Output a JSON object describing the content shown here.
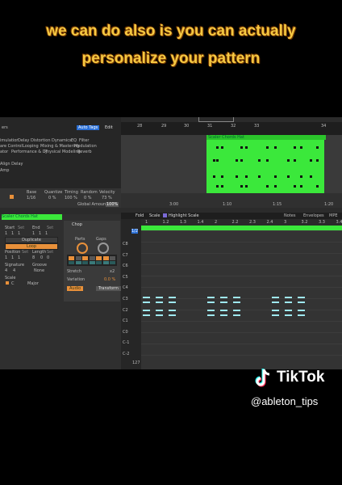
{
  "caption": {
    "line1": "we can do also is you can actually",
    "line2": "personalize your pattern"
  },
  "browser": {
    "items": [
      "ers",
      "imulation",
      "Delay",
      "Distortion",
      "Dynamics",
      "EQ",
      "Filter",
      "are Control",
      "Looping",
      "Mixing & Mastering",
      "Modulation",
      "ator",
      "Performance & DJ",
      "Physical Modeling",
      "Reverb"
    ],
    "auto_tags": "Auto Tags",
    "edit": "Edit",
    "align_delay": "Align Delay",
    "amp": "Amp"
  },
  "grooves": {
    "headers": [
      "Base",
      "Quantize",
      "Timing",
      "Random",
      "Velocity"
    ],
    "values": [
      "1/16",
      "0 %",
      "100 %",
      "0 %",
      "73 %"
    ],
    "global_amount": "Global Amount",
    "global_value": "100%"
  },
  "arrangement": {
    "ruler_top": [
      "28",
      "29",
      "30",
      "31",
      "32",
      "33",
      "34"
    ],
    "clip_name": "Scaler Chords Hat",
    "ruler_bottom": [
      "3:00",
      "1:10",
      "1:15",
      "1:20"
    ]
  },
  "clip_panel": {
    "title": "Scaler Chords Hat",
    "start": "Start",
    "set": "Set",
    "end": "End",
    "start_vals": [
      "1",
      "1",
      "1"
    ],
    "end_vals": [
      "1",
      "1",
      "1"
    ],
    "duplicate": "Duplicate",
    "loop": "Loop",
    "position": "Position",
    "length": "Length",
    "pos_vals": [
      "1",
      "1",
      "1"
    ],
    "len_vals": [
      "8",
      "0",
      "0"
    ],
    "signature": "Signature",
    "groove": "Groove",
    "sig_vals": [
      "4",
      "4"
    ],
    "groove_val": "None",
    "scale": "Scale",
    "scale_root": "C",
    "scale_mode": "Major",
    "chop": "Chop",
    "parts": "Parts",
    "gaps": "Gaps",
    "stretch": "Stretch",
    "stretch_val": "x2",
    "variation": "Variation",
    "variation_val": "0.0 %",
    "audio": "Audio",
    "transform": "Transform"
  },
  "midi_toolbar": {
    "fold": "Fold",
    "scale": "Scale",
    "highlight": "Highlight Scale",
    "notes": "Notes",
    "envelopes": "Envelopes",
    "mpe": "MPE",
    "ruler": [
      "1",
      "1.2",
      "1.3",
      "1.4",
      "2",
      "2.2",
      "2.3",
      "2.4",
      "3",
      "3.2",
      "3.3",
      "3.4"
    ]
  },
  "keys": {
    "labels": [
      "C8",
      "C7",
      "C6",
      "C5",
      "C4",
      "C3",
      "C2",
      "C1",
      "C0",
      "C-1",
      "C-2"
    ],
    "velocity": "127",
    "fraction": "1/2"
  },
  "tiktok": {
    "name": "TikTok",
    "handle": "@ableton_tips"
  },
  "colors": {
    "caption": "#f5c842",
    "clip_green": "#3be83b",
    "note": "#9fe8f0",
    "accent_orange": "#e8903a"
  }
}
